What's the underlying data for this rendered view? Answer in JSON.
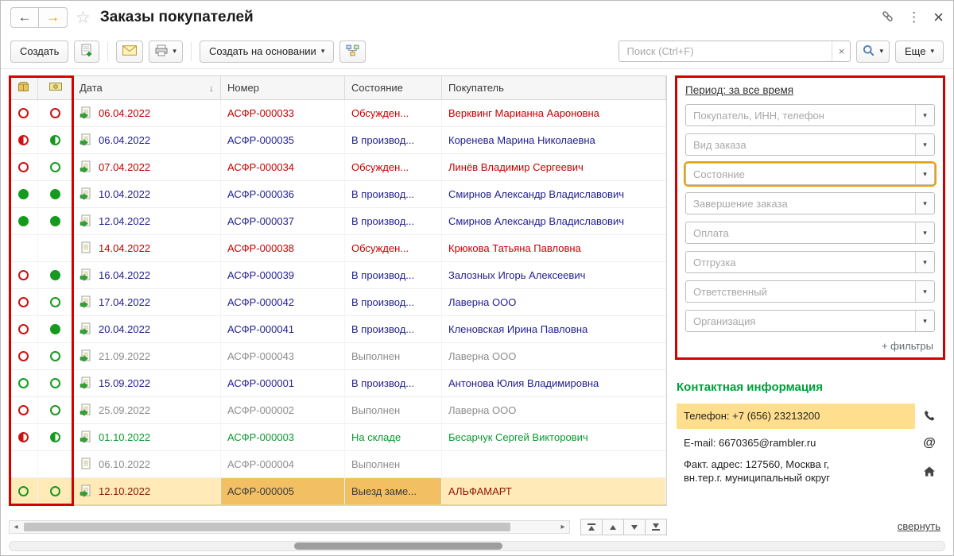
{
  "titlebar": {
    "title": "Заказы покупателей"
  },
  "icons": {
    "back": "←",
    "forward": "→",
    "star": "☆",
    "menu_dots": "⋮",
    "close": "×",
    "caret": "▾",
    "sort_desc": "↓",
    "clear": "×",
    "at_sign": "@",
    "scroll_left": "◂",
    "scroll_right": "▸"
  },
  "toolbar": {
    "create": "Создать",
    "based_on": "Создать на основании",
    "more": "Еще",
    "search_placeholder": "Поиск (Ctrl+F)"
  },
  "table": {
    "headers": {
      "date": "Дата",
      "number": "Номер",
      "state": "Состояние",
      "customer": "Покупатель"
    },
    "rows": [
      {
        "c1": "red-open",
        "c2": "red-open",
        "doc": "posted",
        "date": "06.04.2022",
        "number": "АСФР-000033",
        "state": "Обсужден...",
        "customer": "Верквинг Марианна Аароновна",
        "color": "red"
      },
      {
        "c1": "red-half",
        "c2": "green-half",
        "doc": "posted",
        "date": "06.04.2022",
        "number": "АСФР-000035",
        "state": "В производ...",
        "customer": "Коренева Марина Николаевна",
        "color": "normal"
      },
      {
        "c1": "red-open",
        "c2": "green-open",
        "doc": "posted",
        "date": "07.04.2022",
        "number": "АСФР-000034",
        "state": "Обсужден...",
        "customer": "Линёв Владимир Сергеевич",
        "color": "red"
      },
      {
        "c1": "green-full",
        "c2": "green-full",
        "doc": "posted",
        "date": "10.04.2022",
        "number": "АСФР-000036",
        "state": "В производ...",
        "customer": "Смирнов Александр Владиславович",
        "color": "normal"
      },
      {
        "c1": "green-full",
        "c2": "green-full",
        "doc": "posted",
        "date": "12.04.2022",
        "number": "АСФР-000037",
        "state": "В производ...",
        "customer": "Смирнов Александр Владиславович",
        "color": "normal"
      },
      {
        "c1": "none",
        "c2": "none",
        "doc": "plain",
        "date": "14.04.2022",
        "number": "АСФР-000038",
        "state": "Обсужден...",
        "customer": "Крюкова Татьяна Павловна",
        "color": "red"
      },
      {
        "c1": "red-open",
        "c2": "green-full",
        "doc": "posted",
        "date": "16.04.2022",
        "number": "АСФР-000039",
        "state": "В производ...",
        "customer": "Залозных Игорь Алексеевич",
        "color": "normal"
      },
      {
        "c1": "red-open",
        "c2": "green-open",
        "doc": "posted",
        "date": "17.04.2022",
        "number": "АСФР-000042",
        "state": "В производ...",
        "customer": "Лаверна ООО",
        "color": "normal"
      },
      {
        "c1": "red-open",
        "c2": "green-full",
        "doc": "posted",
        "date": "20.04.2022",
        "number": "АСФР-000041",
        "state": "В производ...",
        "customer": "Кленовская Ирина Павловна",
        "color": "normal"
      },
      {
        "c1": "red-open",
        "c2": "green-open",
        "doc": "posted",
        "date": "21.09.2022",
        "number": "АСФР-000043",
        "state": "Выполнен",
        "customer": "Лаверна ООО",
        "color": "gray"
      },
      {
        "c1": "green-open",
        "c2": "green-open",
        "doc": "posted",
        "date": "15.09.2022",
        "number": "АСФР-000001",
        "state": "В производ...",
        "customer": "Антонова Юлия Владимировна",
        "color": "normal"
      },
      {
        "c1": "red-open",
        "c2": "green-open",
        "doc": "posted",
        "date": "25.09.2022",
        "number": "АСФР-000002",
        "state": "Выполнен",
        "customer": "Лаверна ООО",
        "color": "gray"
      },
      {
        "c1": "red-half",
        "c2": "green-half",
        "doc": "posted",
        "date": "01.10.2022",
        "number": "АСФР-000003",
        "state": "На складе",
        "customer": "Бесарчук Сергей Викторович",
        "color": "green"
      },
      {
        "c1": "none",
        "c2": "none",
        "doc": "plain",
        "date": "06.10.2022",
        "number": "АСФР-000004",
        "state": "Выполнен",
        "customer": "",
        "color": "gray"
      },
      {
        "c1": "green-open",
        "c2": "green-open",
        "doc": "posted",
        "date": "12.10.2022",
        "number": "АСФР-000005",
        "state": "Выезд заме...",
        "customer": "АЛЬФАМАРТ",
        "color": "selected"
      }
    ]
  },
  "filters": {
    "period": "Период: за все время",
    "items": [
      {
        "placeholder": "Покупатель, ИНН, телефон",
        "state": "normal"
      },
      {
        "placeholder": "Вид заказа",
        "state": "normal"
      },
      {
        "placeholder": "Состояние",
        "state": "highlight"
      },
      {
        "placeholder": "Завершение заказа",
        "state": "normal"
      },
      {
        "placeholder": "Оплата",
        "state": "normal"
      },
      {
        "placeholder": "Отгрузка",
        "state": "normal"
      },
      {
        "placeholder": "Ответственный",
        "state": "normal"
      },
      {
        "placeholder": "Организация",
        "state": "normal"
      }
    ],
    "more": "+ фильтры"
  },
  "contacts": {
    "title": "Контактная информация",
    "phone": "Телефон: +7 (656) 23213200",
    "email": "E-mail: 6670365@rambler.ru",
    "address1": "Факт. адрес: 127560, Москва г,",
    "address2": "вн.тер.г. муниципальный округ"
  },
  "footer": {
    "collapse": "свернуть"
  },
  "colors": {
    "annotation": "#d40000",
    "highlight_outline": "#eea000",
    "selected_row_bg": "#ffeab8",
    "selected_cell_bg": "#f2bf63",
    "phone_highlight_bg": "#ffdf8d",
    "contacts_title": "#00a03a",
    "row_normal": "#1f1f8f",
    "row_red": "#c40000",
    "row_gray": "#8c8c8c",
    "row_green": "#089a2e"
  }
}
